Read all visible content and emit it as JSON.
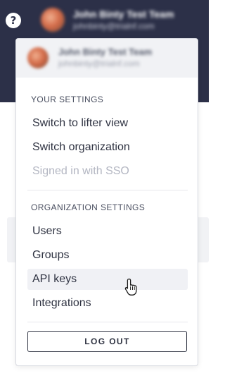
{
  "header": {
    "help_icon": "question-circle-icon",
    "help_glyph": "?",
    "user_name": "John Binty Test Team",
    "user_email": "johnbinty@trialnf.com"
  },
  "menu": {
    "user_name": "John Binty Test Team",
    "user_email": "johnbinty@trialnf.com",
    "your_settings": {
      "header": "YOUR SETTINGS",
      "items": [
        {
          "label": "Switch to lifter view",
          "enabled": true
        },
        {
          "label": "Switch organization",
          "enabled": true
        },
        {
          "label": "Signed in with SSO",
          "enabled": false
        }
      ]
    },
    "organization_settings": {
      "header": "ORGANIZATION SETTINGS",
      "items": [
        {
          "label": "Users"
        },
        {
          "label": "Groups"
        },
        {
          "label": "API keys",
          "hovered": true
        },
        {
          "label": "Integrations"
        }
      ]
    },
    "logout_label": "LOG OUT"
  },
  "cursor": {
    "icon": "pointer-hand-icon"
  },
  "colors": {
    "header_bg": "#2c3048",
    "menu_text": "#2f3342",
    "disabled_text": "#b3b6c2",
    "hover_bg": "#f0f1f5"
  }
}
